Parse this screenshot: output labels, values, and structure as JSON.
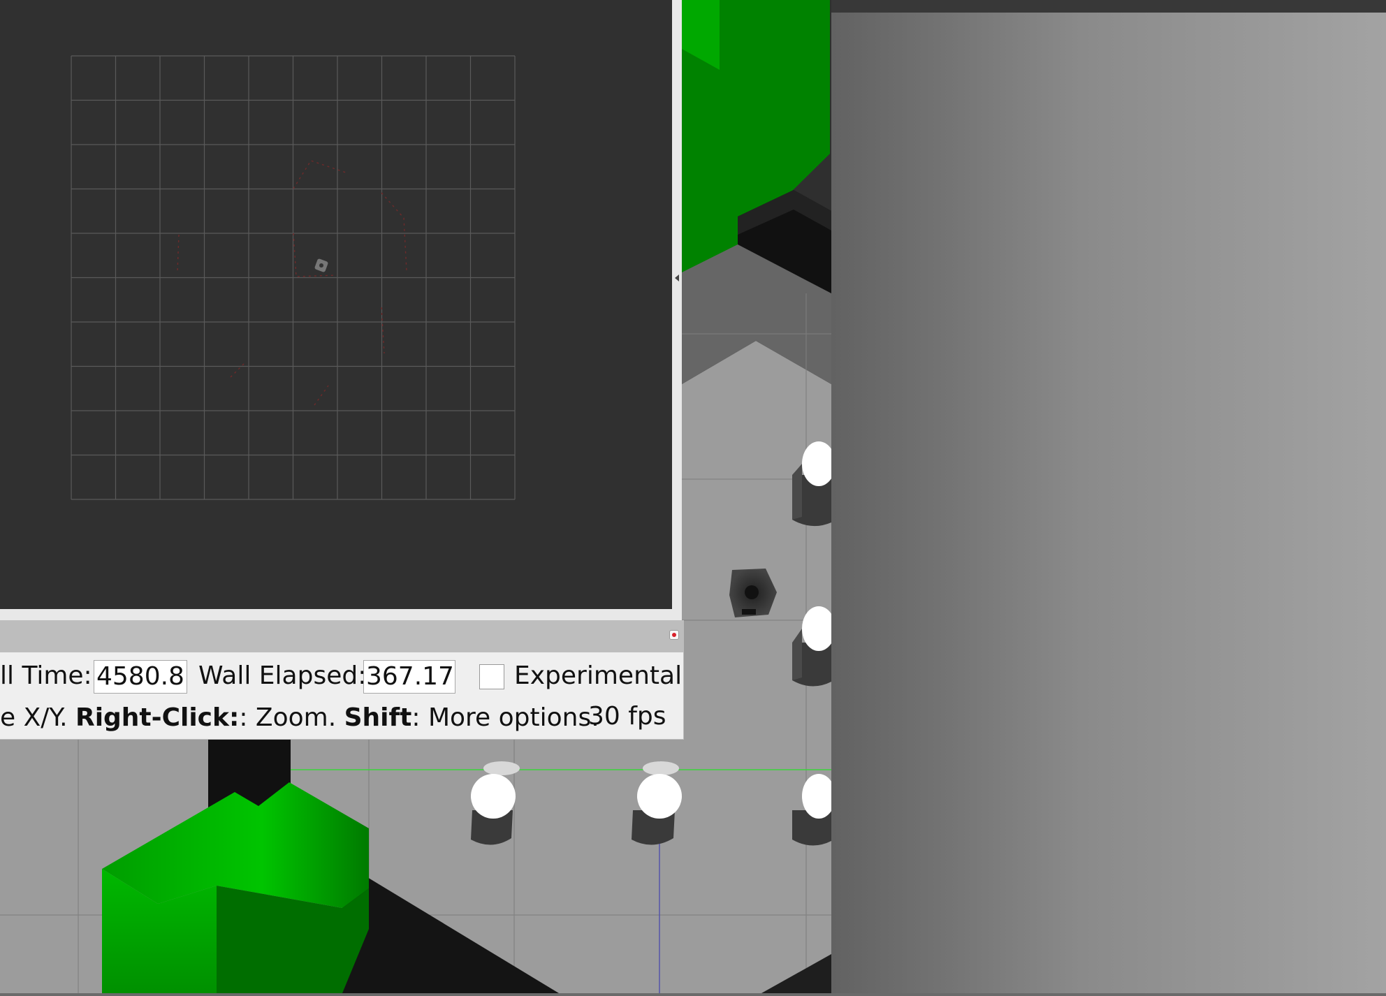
{
  "status_bar": {
    "sim_time_label": "ll Time:",
    "sim_time_value": "4580.81",
    "wall_elapsed_label": "Wall Elapsed:",
    "wall_elapsed_value": "367.17",
    "experimental_label": "Experimental",
    "experimental_checked": false,
    "help_prefix": "e X/Y. ",
    "help_right_click_key": "Right-Click:",
    "help_right_click_text": ": Zoom. ",
    "help_shift_key": "Shift",
    "help_shift_text": ": More options.",
    "fps": "30 fps"
  },
  "map_view": {
    "background": "#303030",
    "grid_color": "#5a5a5a",
    "laser_color": "#7a2f2f",
    "grid_rows": 10,
    "grid_cols": 10
  },
  "scene": {
    "floor_color": "#9c9c9c",
    "obstacle_color": "#00c000",
    "wall_color": "#111111",
    "pillar_color": "#ffffff",
    "right_panel_top_color": "#383838"
  },
  "icons": {
    "panel_close": "close-icon",
    "splitter": "chevron-left-icon"
  }
}
